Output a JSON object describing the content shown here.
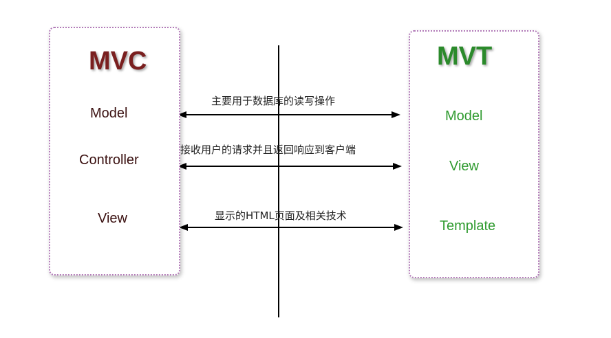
{
  "colors": {
    "mvc_title": "#7a1f1f",
    "mvt_title": "#2b8a2b",
    "mvc_items": "#3a1010",
    "mvt_items": "#2e9a2e",
    "box_border": "#b27ab8",
    "lines": "#000000"
  },
  "mvc": {
    "title": "MVC",
    "items": [
      "Model",
      "Controller",
      "View"
    ]
  },
  "mvt": {
    "title": "MVT",
    "items": [
      "Model",
      "View",
      "Template"
    ]
  },
  "mappings": [
    {
      "description": "主要用于数据库的读写操作"
    },
    {
      "description": "接收用户的请求并且返回响应到客户端"
    },
    {
      "description": "显示的HTML页面及相关技术"
    }
  ]
}
